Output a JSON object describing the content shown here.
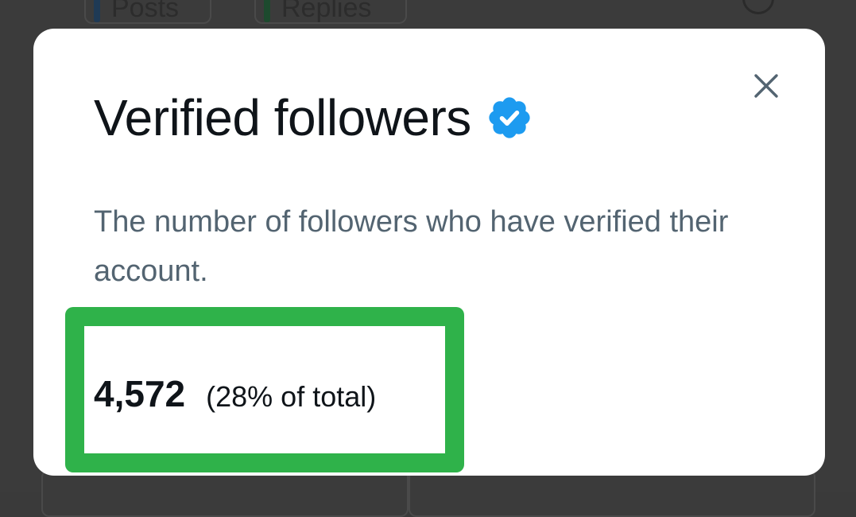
{
  "background": {
    "tabs": [
      {
        "label": "Posts",
        "bar_color": "#1f3a55"
      },
      {
        "label": "Replies",
        "bar_color": "#1d4a2e"
      }
    ]
  },
  "modal": {
    "title": "Verified followers",
    "badge_icon": "verified-badge-icon",
    "badge_color": "#1d9bf0",
    "close_icon": "close-icon",
    "description": "The number of followers who have verified their account.",
    "stat": {
      "value": "4,572",
      "percent_text": "(28% of total)"
    },
    "highlight_color": "#2fb24a"
  }
}
